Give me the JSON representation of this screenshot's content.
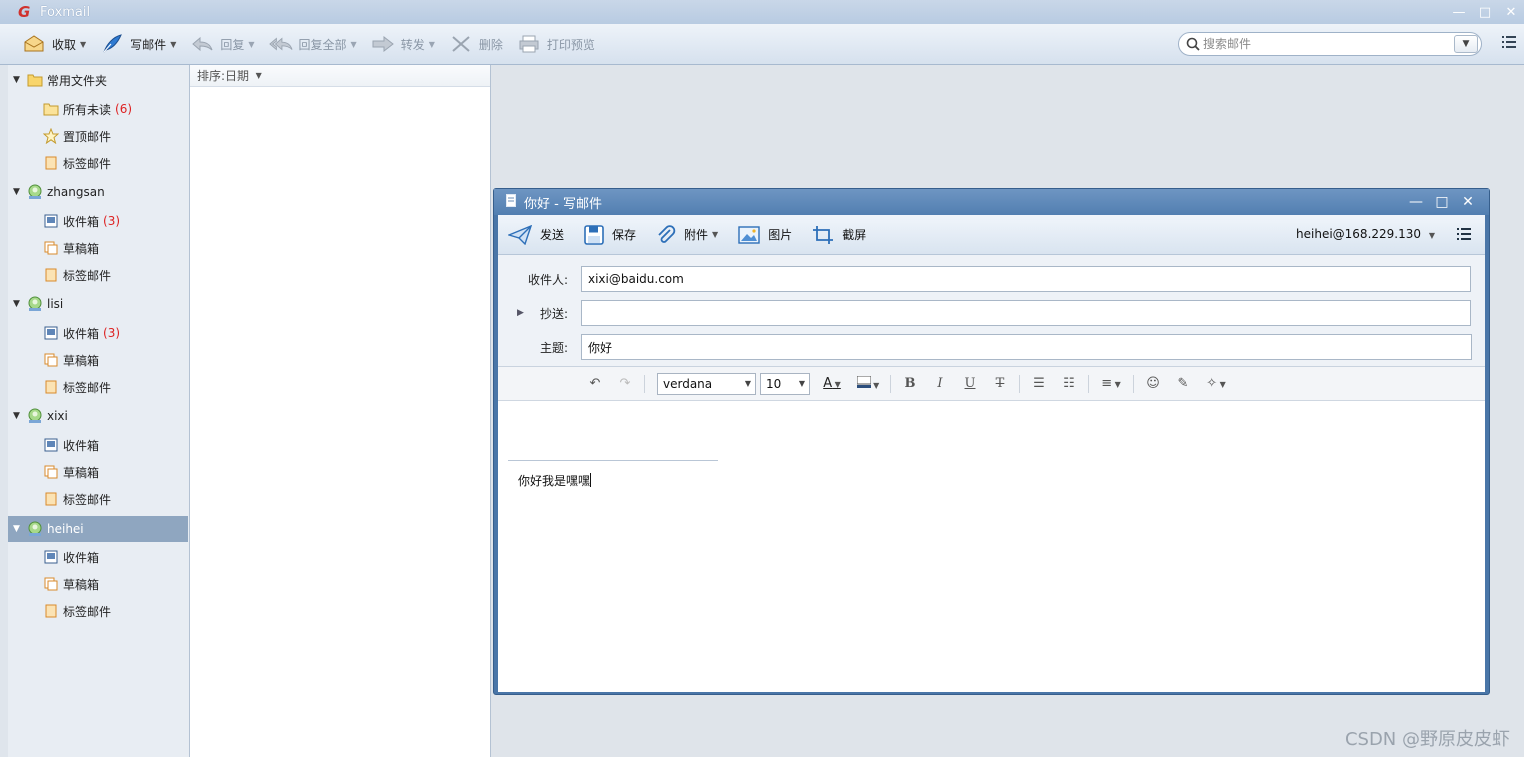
{
  "app": {
    "title": "Foxmail",
    "logo_glyph": "G"
  },
  "window_controls": {
    "minimize": "—",
    "maximize": "□",
    "close": "✕"
  },
  "toolbar": {
    "receive": "收取",
    "compose": "写邮件",
    "reply": "回复",
    "reply_all": "回复全部",
    "forward": "转发",
    "delete": "删除",
    "print_preview": "打印预览"
  },
  "search": {
    "placeholder": "搜索邮件"
  },
  "folders": {
    "common": {
      "label": "常用文件夹",
      "items": [
        {
          "label": "所有未读",
          "count": "(6)"
        },
        {
          "label": "置顶邮件"
        },
        {
          "label": "标签邮件"
        }
      ]
    },
    "accounts": [
      {
        "name": "zhangsan",
        "inbox": "收件箱",
        "inbox_count": "(3)",
        "drafts": "草稿箱",
        "tagged": "标签邮件"
      },
      {
        "name": "lisi",
        "inbox": "收件箱",
        "inbox_count": "(3)",
        "drafts": "草稿箱",
        "tagged": "标签邮件"
      },
      {
        "name": "xixi",
        "inbox": "收件箱",
        "drafts": "草稿箱",
        "tagged": "标签邮件"
      },
      {
        "name": "heihei",
        "inbox": "收件箱",
        "drafts": "草稿箱",
        "tagged": "标签邮件"
      }
    ]
  },
  "maillist": {
    "sort_label": "排序:日期"
  },
  "compose": {
    "title": "你好 - 写邮件",
    "toolbar": {
      "send": "发送",
      "save": "保存",
      "attach": "附件",
      "image": "图片",
      "screenshot": "截屏",
      "account": "heihei@168.229.130"
    },
    "to_label": "收件人:",
    "to_value": "xixi@baidu.com",
    "cc_label": "抄送:",
    "cc_value": "",
    "subject_label": "主题:",
    "subject_value": "你好",
    "font_family": "verdana",
    "font_size": "10",
    "body": "你好我是嘿嘿"
  },
  "watermark": "CSDN @野原皮皮虾",
  "colors": {
    "accent": "#4a76a8",
    "count_red": "#d22222",
    "selected_row": "#8fa6c0"
  }
}
